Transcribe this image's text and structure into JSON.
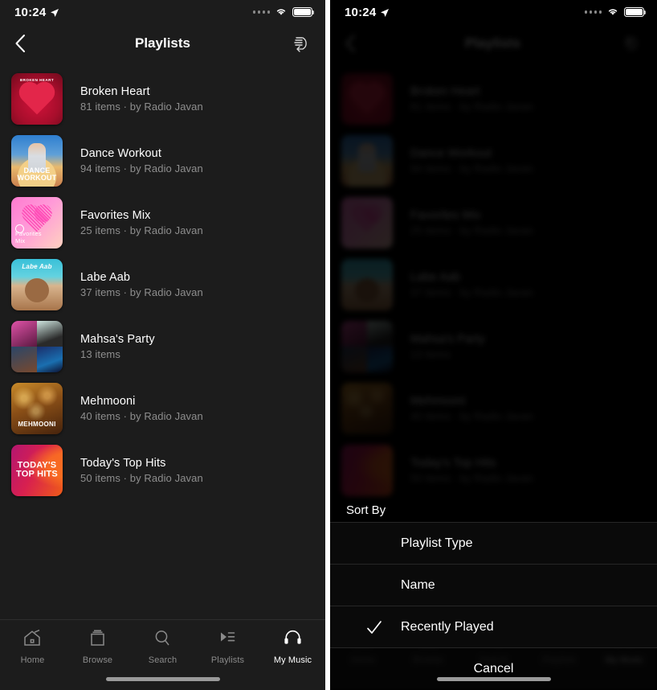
{
  "status_bar": {
    "time": "10:24",
    "location_icon": "location-arrow-icon",
    "signal_icon": "signal-dots-icon",
    "wifi_icon": "wifi-icon",
    "battery_icon": "battery-full-icon"
  },
  "nav": {
    "back_icon": "chevron-left-icon",
    "title": "Playlists",
    "sort_icon": "sort-icon"
  },
  "playlists": [
    {
      "title": "Broken Heart",
      "subtitle": "81 items · by Radio Javan",
      "art_text": "BROKEN HEART",
      "art_class": "a-broken"
    },
    {
      "title": "Dance Workout",
      "subtitle": "94 items · by Radio Javan",
      "art_text": "DANCE\nWORKOUT",
      "art_class": "a-dance"
    },
    {
      "title": "Favorites Mix",
      "subtitle": "25 items · by Radio Javan",
      "art_text": "Favorites\nMix",
      "art_class": "a-fav"
    },
    {
      "title": "Labe Aab",
      "subtitle": "37 items · by Radio Javan",
      "art_text": "Labe Aab",
      "art_class": "a-labe"
    },
    {
      "title": "Mahsa's Party",
      "subtitle": "13 items",
      "art_text": "",
      "art_class": "a-mahsa"
    },
    {
      "title": "Mehmooni",
      "subtitle": "40 items · by Radio Javan",
      "art_text": "MEHMOONI",
      "art_class": "a-mehmooni"
    },
    {
      "title": "Today's Top Hits",
      "subtitle": "50 items · by Radio Javan",
      "art_text": "TODAY'S\nTOP HITS",
      "art_class": "a-hits"
    }
  ],
  "tabbar": {
    "items": [
      {
        "label": "Home",
        "icon": "home-icon",
        "active": false
      },
      {
        "label": "Browse",
        "icon": "browse-icon",
        "active": false
      },
      {
        "label": "Search",
        "icon": "search-icon",
        "active": false
      },
      {
        "label": "Playlists",
        "icon": "playlists-icon",
        "active": false
      },
      {
        "label": "My Music",
        "icon": "headphones-icon",
        "active": true
      }
    ]
  },
  "sort_sheet": {
    "heading": "Sort By",
    "options": [
      {
        "label": "Playlist Type",
        "selected": false
      },
      {
        "label": "Name",
        "selected": false
      },
      {
        "label": "Recently Played",
        "selected": true
      }
    ],
    "cancel_label": "Cancel",
    "check_icon": "check-icon"
  },
  "colors": {
    "background": "#1c1c1c",
    "sheet_background": "#0a0a0a",
    "text_primary": "#ffffff",
    "text_secondary": "#8e8e8e",
    "tab_inactive": "#8a8a8a"
  }
}
